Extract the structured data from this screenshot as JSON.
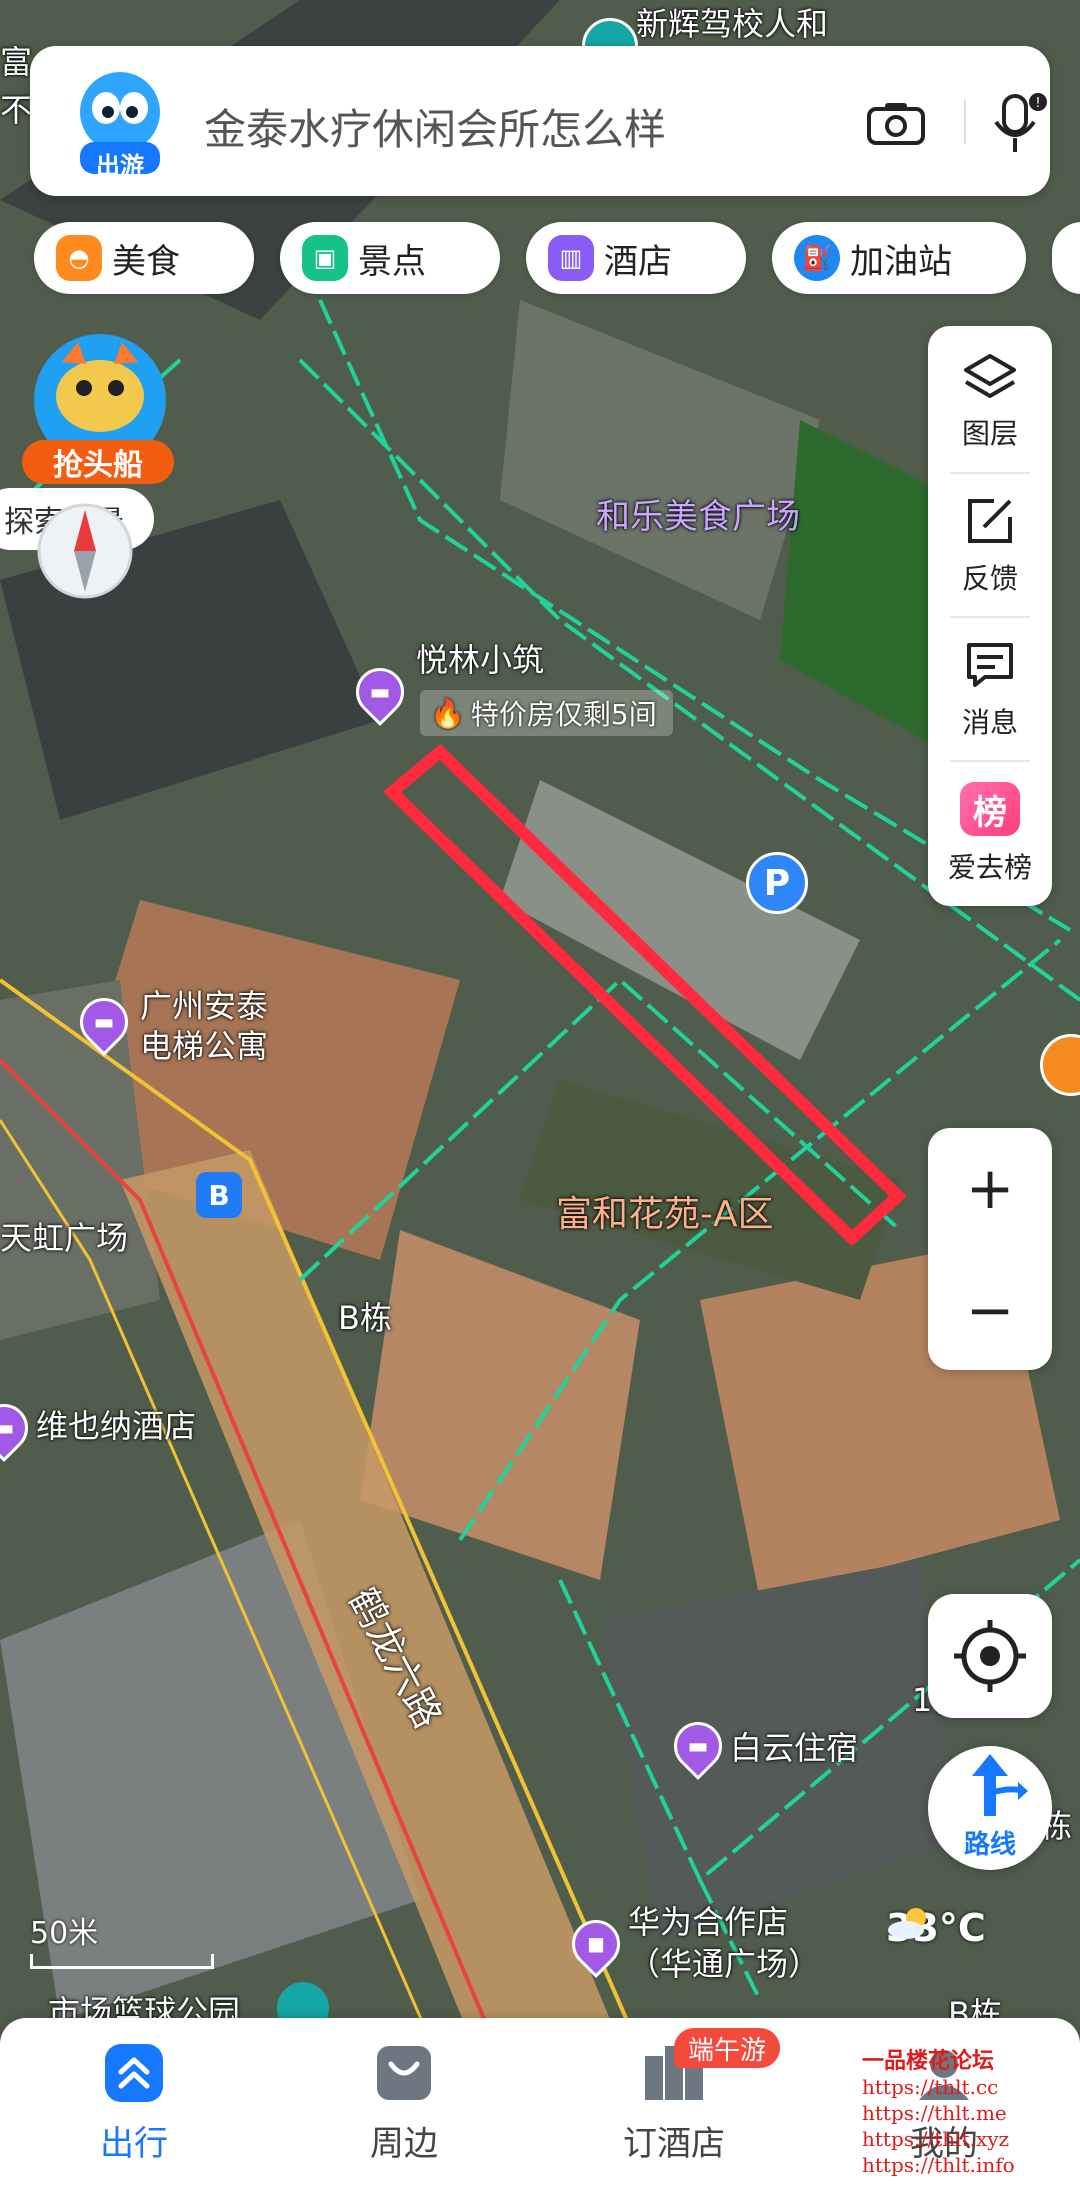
{
  "search": {
    "placeholder": "金泰水疗休闲会所怎么样",
    "logo_label": "出游"
  },
  "categories": [
    {
      "label": "美食",
      "icon": "food-icon",
      "color": "#ff8a1f"
    },
    {
      "label": "景点",
      "icon": "scenery-icon",
      "color": "#15c38a"
    },
    {
      "label": "酒店",
      "icon": "hotel-icon",
      "color": "#8a5cf6"
    },
    {
      "label": "加油站",
      "icon": "gas-station-icon",
      "color": "#1e88f5"
    }
  ],
  "right_panel": [
    {
      "label": "图层",
      "icon": "layers-icon"
    },
    {
      "label": "反馈",
      "icon": "feedback-icon"
    },
    {
      "label": "消息",
      "icon": "message-icon"
    },
    {
      "label": "爱去榜",
      "icon": "ranking-icon"
    }
  ],
  "promo": {
    "label": "抢头船",
    "streetview": "探索街景"
  },
  "map": {
    "top_poi": "新辉驾校人和",
    "edge_texts": [
      "富",
      "不",
      "1栋",
      "栋",
      "B栋"
    ],
    "labels": {
      "food_plaza": "和乐美食广场",
      "garden": "富和花苑-A区",
      "b_building": "B栋",
      "tianhong": "天虹广场",
      "road": "鹤龙六路",
      "basketball": "市场篮球公园"
    },
    "pois": {
      "yuelin": "悦林小筑",
      "yuelin_deal": "特价房仅剩5间",
      "antai_line1": "广州安泰",
      "antai_line2": "电梯公寓",
      "vienna": "维也纳酒店",
      "baiyun": "白云住宿",
      "huawei_line1": "华为合作店",
      "huawei_line2": "（华通广场）"
    },
    "parking": "P",
    "bus": "B",
    "scale": "50米"
  },
  "weather": {
    "temp": "33°C"
  },
  "route_button": {
    "label": "路线"
  },
  "bottom_nav": [
    {
      "label": "出行",
      "icon": "travel-icon",
      "active": true
    },
    {
      "label": "周边",
      "icon": "nearby-icon",
      "active": false
    },
    {
      "label": "订酒店",
      "icon": "hotel-booking-icon",
      "active": false
    },
    {
      "label": "我的",
      "icon": "profile-icon",
      "active": false
    }
  ],
  "nav_badge": "端午游",
  "watermark": [
    "一品楼花论坛",
    "https://thlt.cc",
    "https://thlt.me",
    "https://thlt.xyz",
    "https://thlt.info"
  ]
}
